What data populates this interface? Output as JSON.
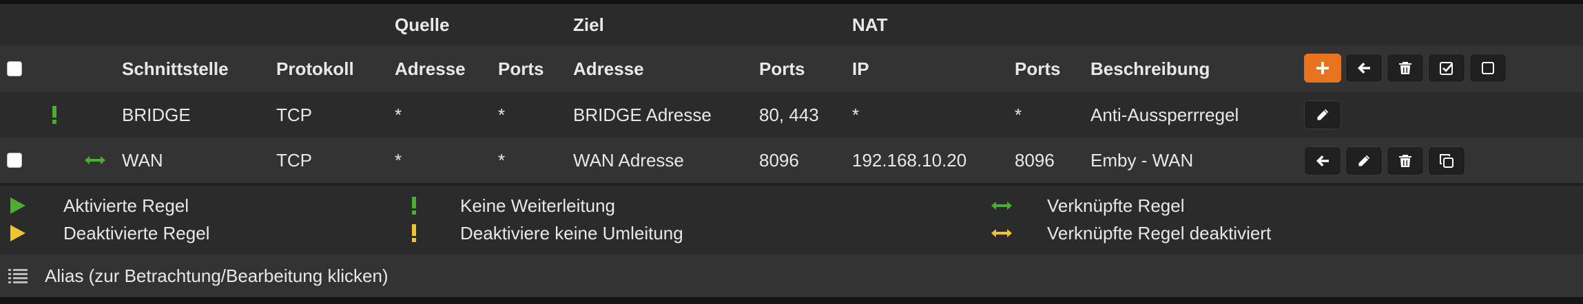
{
  "group_headers": {
    "source": "Quelle",
    "destination": "Ziel",
    "nat": "NAT"
  },
  "columns": {
    "interface": "Schnittstelle",
    "protocol": "Protokoll",
    "src_address": "Adresse",
    "src_ports": "Ports",
    "dst_address": "Adresse",
    "dst_ports": "Ports",
    "nat_ip": "IP",
    "nat_ports": "Ports",
    "description": "Beschreibung"
  },
  "rows": [
    {
      "status_icon": "no-redirect-exclamation-icon",
      "interface": "BRIDGE",
      "protocol": "TCP",
      "src_address": "*",
      "src_ports": "*",
      "dst_address": "BRIDGE Adresse",
      "dst_ports": "80, 443",
      "nat_ip": "*",
      "nat_ports": "*",
      "description": "Anti-Aussperrregel",
      "actions": [
        "edit-icon"
      ]
    },
    {
      "status_icon": "linked-rule-arrows-icon",
      "interface": "WAN",
      "protocol": "TCP",
      "src_address": "*",
      "src_ports": "*",
      "dst_address": "WAN Adresse",
      "dst_ports": "8096",
      "nat_ip": "192.168.10.20",
      "nat_ports": "8096",
      "description": "Emby - WAN",
      "actions": [
        "move-before-icon",
        "edit-icon",
        "delete-icon",
        "copy-icon"
      ]
    }
  ],
  "header_actions": [
    "add-icon",
    "move-icon",
    "delete-icon",
    "enable-icon",
    "disable-icon"
  ],
  "legend": {
    "enabled_rule": "Aktivierte Regel",
    "disabled_rule": "Deaktivierte Regel",
    "no_redirect": "Keine Weiterleitung",
    "disable_no_redirect": "Deaktiviere keine Umleitung",
    "linked_rule": "Verknüpfte Regel",
    "linked_rule_disabled": "Verknüpfte Regel deaktiviert"
  },
  "alias": {
    "label": "Alias (zur Betrachtung/Bearbeitung klicken)"
  },
  "colors": {
    "green": "#4cae2e",
    "yellow": "#f0c330",
    "orange": "#e8731f",
    "background": "#2b2b2b"
  }
}
